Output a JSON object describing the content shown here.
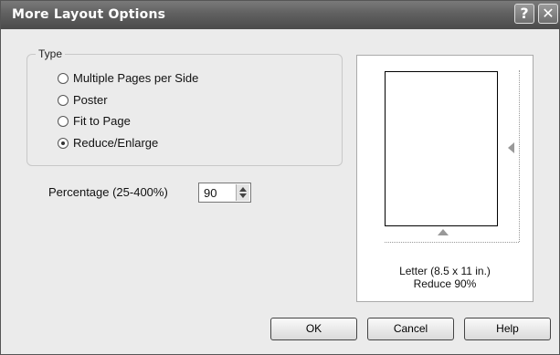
{
  "window": {
    "title": "More Layout Options",
    "help_glyph": "?",
    "close_glyph": "✕"
  },
  "type_group": {
    "legend": "Type",
    "options": [
      {
        "label": "Multiple Pages per Side",
        "selected": false
      },
      {
        "label": "Poster",
        "selected": false
      },
      {
        "label": "Fit to Page",
        "selected": false
      },
      {
        "label": "Reduce/Enlarge",
        "selected": true
      }
    ]
  },
  "percentage": {
    "label": "Percentage (25-400%)",
    "value": "90"
  },
  "preview": {
    "paper_size": "Letter (8.5 x 11 in.)",
    "status": "Reduce 90%"
  },
  "buttons": {
    "ok": "OK",
    "cancel": "Cancel",
    "help": "Help"
  },
  "icons": {
    "help": "help-icon",
    "close": "close-icon",
    "spin_up": "chevron-up-icon",
    "spin_down": "chevron-down-icon"
  }
}
